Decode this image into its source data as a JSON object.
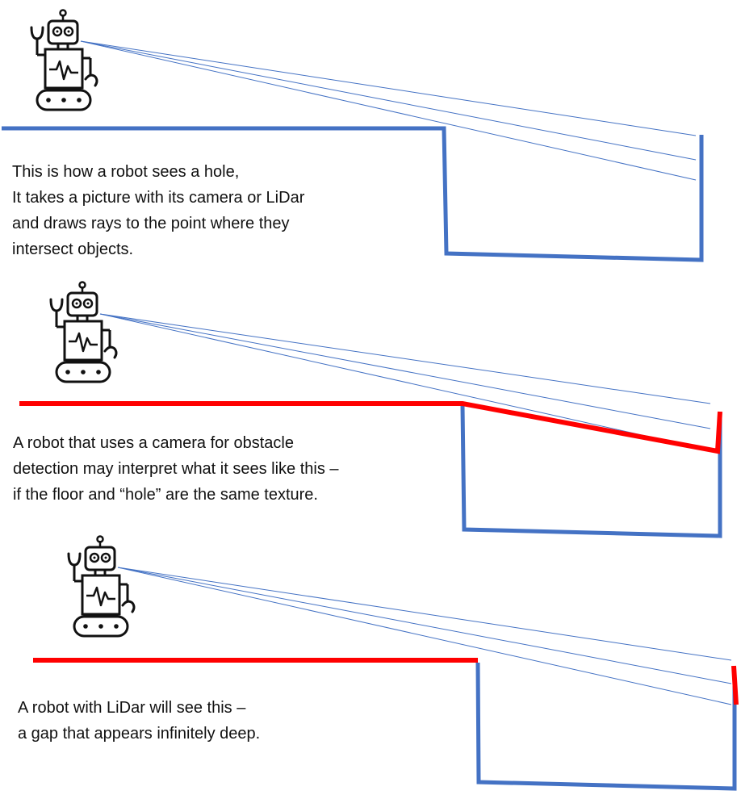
{
  "colors": {
    "true_surface": "#4472C4",
    "perceived_surface": "#FF0000",
    "ray": "#4472C4",
    "robot_line": "#111111",
    "background": "#FFFFFF"
  },
  "icons": [
    "robot-icon",
    "rays"
  ],
  "panels": [
    {
      "id": "hole",
      "caption_lines": [
        "This is how a robot sees a hole,",
        "It takes a picture with its camera or LiDar",
        "and draws rays to the point where they",
        "intersect objects."
      ]
    },
    {
      "id": "camera",
      "caption_lines": [
        "A robot that uses a camera for obstacle",
        "detection may interpret what it sees like this –",
        "if the floor and “hole” are the same texture."
      ]
    },
    {
      "id": "lidar",
      "caption_lines": [
        "A robot with  LiDar will see this –",
        "a gap that appears infinitely deep."
      ]
    }
  ]
}
